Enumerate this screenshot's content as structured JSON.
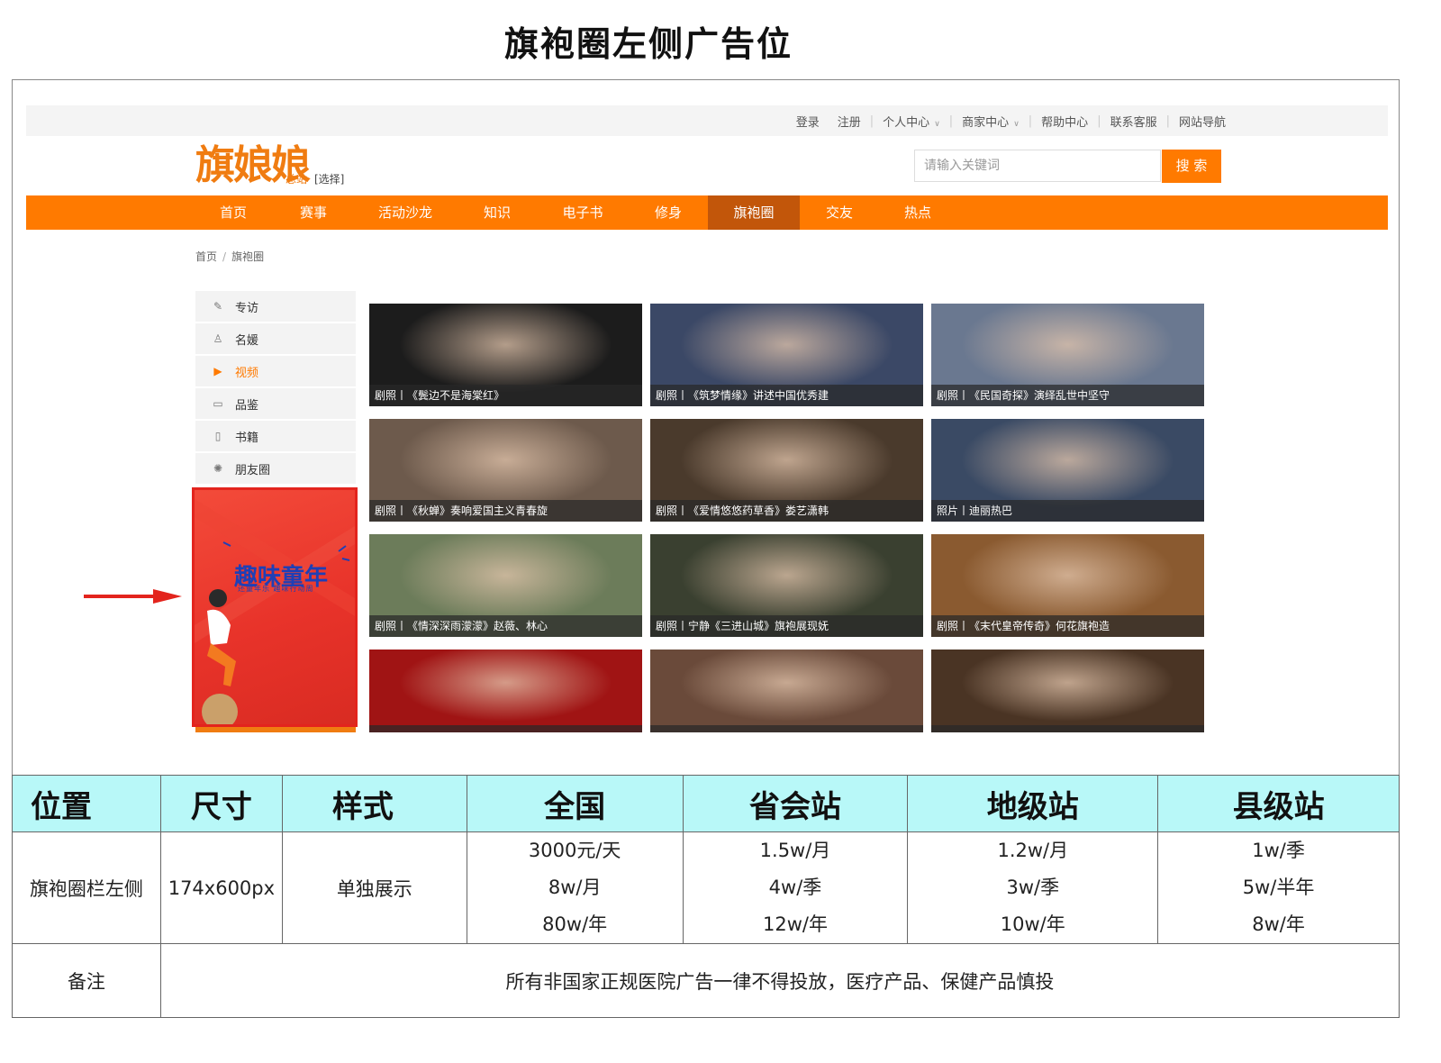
{
  "page_title": "旗袍圈左侧广告位",
  "topbar": {
    "links": [
      {
        "label": "登录",
        "chevron": false
      },
      {
        "label": "注册",
        "chevron": false
      },
      {
        "label": "个人中心",
        "chevron": true
      },
      {
        "label": "商家中心",
        "chevron": true
      },
      {
        "label": "帮助中心",
        "chevron": false
      },
      {
        "label": "联系客服",
        "chevron": false
      },
      {
        "label": "网站导航",
        "chevron": false
      }
    ]
  },
  "header": {
    "logo_text": "旗娘娘",
    "site_name": "总站",
    "site_choose": "[选择]",
    "search_placeholder": "请输入关键词",
    "search_button": "搜 索"
  },
  "nav": {
    "active": "旗袍圈",
    "items": [
      "首页",
      "赛事",
      "活动沙龙",
      "知识",
      "电子书",
      "修身",
      "旗袍圈",
      "交友",
      "热点"
    ]
  },
  "breadcrumb": {
    "home": "首页",
    "separator": "/",
    "current": "旗袍圈"
  },
  "side_menu": {
    "active": "视频",
    "items": [
      {
        "label": "专访",
        "icon": "edit-icon"
      },
      {
        "label": "名媛",
        "icon": "person-icon"
      },
      {
        "label": "视频",
        "icon": "video-icon"
      },
      {
        "label": "品鉴",
        "icon": "screen-icon"
      },
      {
        "label": "书籍",
        "icon": "book-icon"
      },
      {
        "label": "朋友圈",
        "icon": "camera-aperture-icon"
      }
    ]
  },
  "ad": {
    "title": "趣味童年",
    "top_tiny": "",
    "sub_tiny": "还童年乐  趣味行动周"
  },
  "cards": [
    {
      "caption": "剧照丨《鬓边不是海棠红》",
      "tone": "#1c1c1c"
    },
    {
      "caption": "剧照丨《筑梦情缘》讲述中国优秀建",
      "tone": "#3b4866"
    },
    {
      "caption": "剧照丨《民国奇探》演绎乱世中坚守",
      "tone": "#6a7890"
    },
    {
      "caption": "剧照丨《秋蝉》奏响爱国主义青春旋",
      "tone": "#6d5a4c"
    },
    {
      "caption": "剧照丨《爱情悠悠药草香》娄艺潇韩",
      "tone": "#4a3a2c"
    },
    {
      "caption": "照片丨迪丽热巴",
      "tone": "#3a4a64"
    },
    {
      "caption": "剧照丨《情深深雨濛濛》赵薇、林心",
      "tone": "#6c7c5a"
    },
    {
      "caption": "剧照丨宁静《三进山城》旗袍展现妩",
      "tone": "#3a4030"
    },
    {
      "caption": "剧照丨《末代皇帝传奇》何花旗袍造",
      "tone": "#8a5a30"
    },
    {
      "caption": "",
      "tone": "#a01414"
    },
    {
      "caption": "",
      "tone": "#6a4a3a"
    },
    {
      "caption": "",
      "tone": "#4a3424"
    }
  ],
  "table": {
    "headers": [
      "位置",
      "尺寸",
      "样式",
      "全国",
      "省会站",
      "地级站",
      "县级站"
    ],
    "row": {
      "position": "旗袍圈栏左侧",
      "size": "174x600px",
      "style": "单独展示",
      "national": [
        "3000元/天",
        "8w/月",
        "80w/年"
      ],
      "provincial": [
        "1.5w/月",
        "4w/季",
        "12w/年"
      ],
      "prefecture": [
        "1.2w/月",
        "3w/季",
        "10w/年"
      ],
      "county": [
        "1w/季",
        "5w/半年",
        "8w/年"
      ]
    },
    "note_label": "备注",
    "note_text": "所有非国家正规医院广告一律不得投放，医疗产品、保健产品慎投"
  },
  "colors": {
    "accent": "#ff7a00",
    "nav_active": "#c2560a",
    "ad_bg": "#e8332a",
    "ad_text": "#1f3fb6",
    "arrow": "#e3241d",
    "table_header": "#b8f8f8"
  }
}
